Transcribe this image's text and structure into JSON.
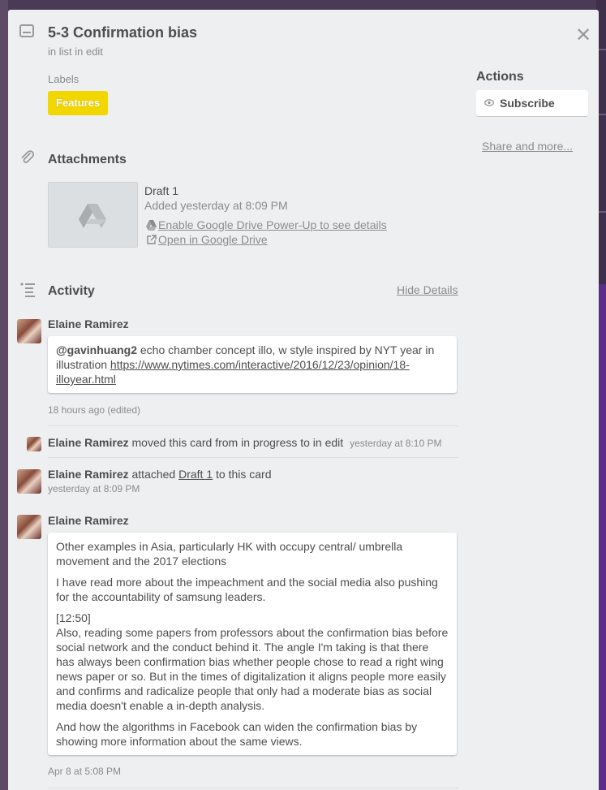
{
  "card": {
    "title": "5-3 Confirmation bias",
    "list_line": "in list in edit",
    "labels_heading": "Labels",
    "label": {
      "text": "Features",
      "color": "#f2d600"
    }
  },
  "attachments": {
    "heading": "Attachments",
    "icon": "paperclip-icon",
    "item": {
      "name": "Draft 1",
      "added": "Added yesterday at 8:09 PM",
      "power_up_link": "Enable Google Drive Power-Up to see details",
      "open_link": "Open in Google Drive",
      "thumb_icon": "google-drive-icon"
    }
  },
  "activity": {
    "heading": "Activity",
    "hide_details": "Hide Details",
    "entries": [
      {
        "author": "Elaine Ramirez",
        "mention": "@gavinhuang2",
        "text": " echo chamber concept illo, w style inspired by NYT year in illustration ",
        "url": "https://www.nytimes.com/interactive/2016/12/23/opinion/18-illoyear.html",
        "time": "18 hours ago (edited)"
      },
      {
        "author": "Elaine Ramirez",
        "text": "moved this card from in progress to in edit",
        "time": "yesterday at 8:10 PM"
      },
      {
        "author": "Elaine Ramirez",
        "text_before": "attached",
        "link": "Draft 1",
        "text_after": "to this card",
        "time": "yesterday at 8:09 PM"
      },
      {
        "author": "Elaine Ramirez",
        "paragraphs": [
          "Other examples in Asia, particularly HK with occupy central/ umbrella movement and the 2017 elections",
          "I have read more about the impeachment and the social media also pushing for the accountability of samsung leaders.",
          "[12:50]",
          "Also, reading some papers from professors about the confirmation bias before social network and the conduct behind it. The angle I'm taking is that there has always been confirmation bias whether people chose to read a right wing news paper or so. But in the times of digitalization it aligns people more easily and confirms and radicalize people that only had a moderate bias as social media doesn't enable a in-depth analysis.",
          "And how the algorithms in Facebook can widen the confirmation bias by showing more information about the same views."
        ],
        "time": "Apr 8 at 5:08 PM"
      }
    ]
  },
  "sidebar": {
    "actions_heading": "Actions",
    "subscribe_label": "Subscribe",
    "share_more": "Share and more..."
  },
  "close_icon": "close-icon"
}
